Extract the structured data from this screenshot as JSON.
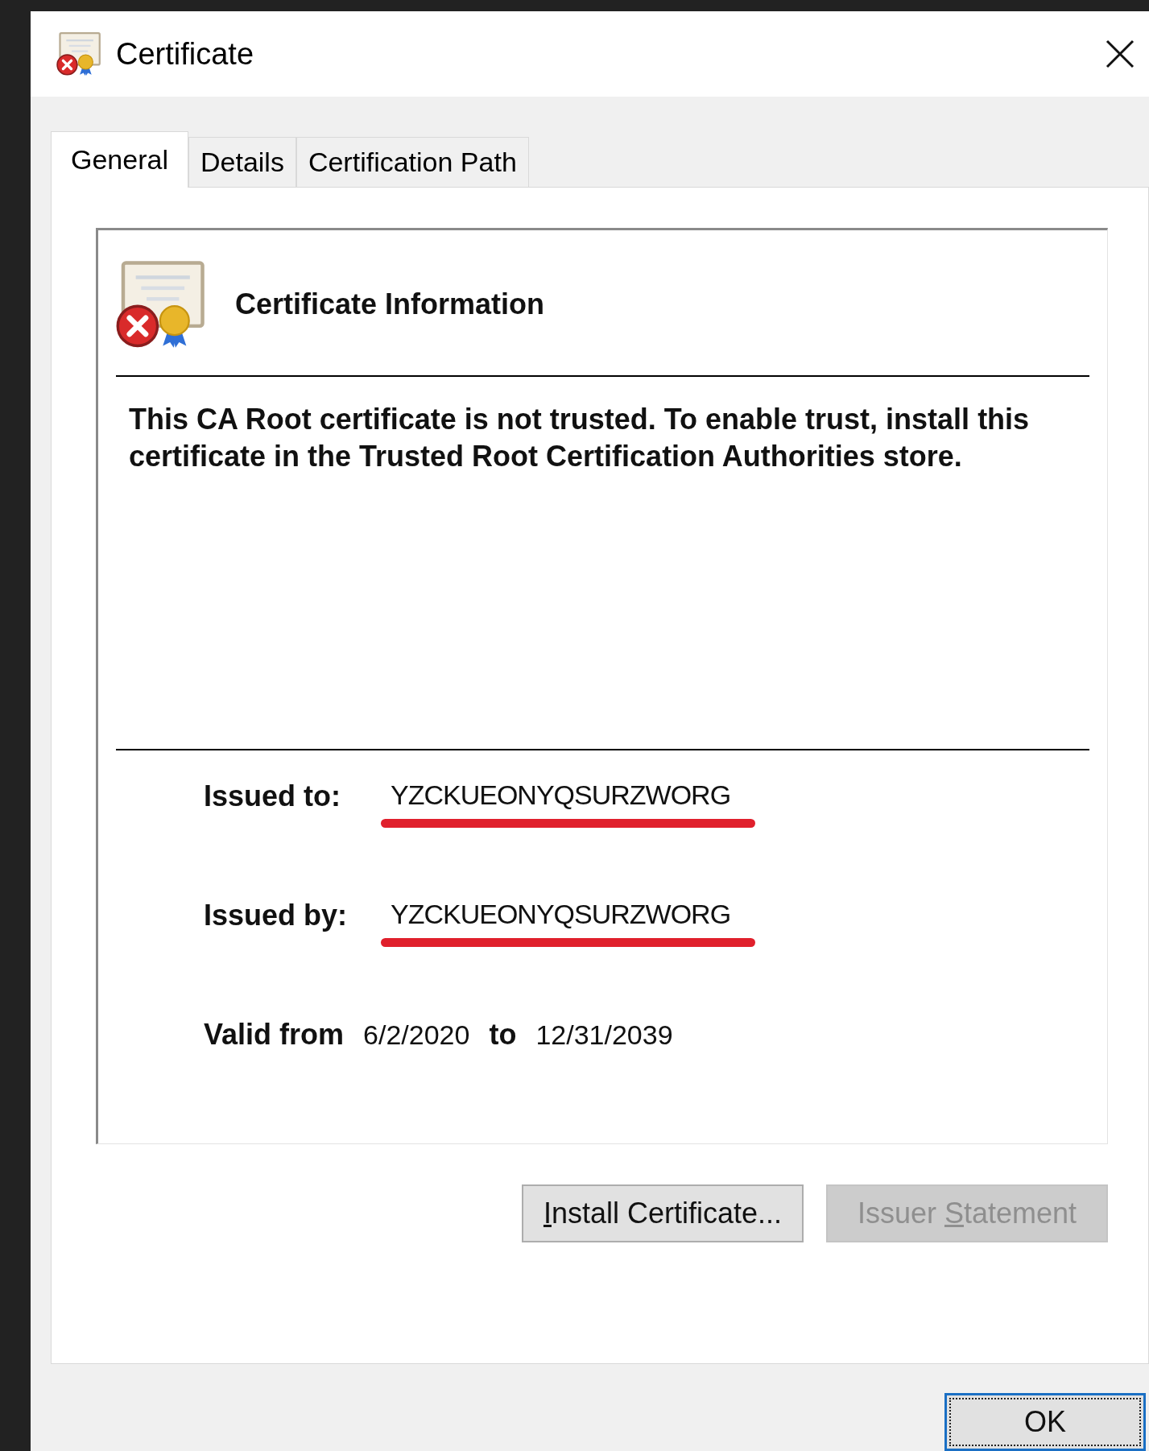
{
  "window": {
    "title": "Certificate"
  },
  "tabs": [
    {
      "label": "General",
      "selected": true
    },
    {
      "label": "Details",
      "selected": false
    },
    {
      "label": "Certification Path",
      "selected": false
    }
  ],
  "info": {
    "heading": "Certificate Information",
    "message": "This CA Root certificate is not trusted. To enable trust, install this certificate in the Trusted Root Certification Authorities store.",
    "fields": [
      {
        "label": "Issued to:",
        "value": "YZCKUEONYQSURZWORG",
        "marked": true
      },
      {
        "label": "Issued by:",
        "value": "YZCKUEONYQSURZWORG",
        "marked": true
      }
    ],
    "validity": {
      "from_label": "Valid from",
      "from": "6/2/2020",
      "to_label": "to",
      "to": "12/31/2039"
    }
  },
  "panel_buttons": [
    {
      "key": "I",
      "after": "nstall Certificate...",
      "disabled": false
    },
    {
      "before": "Issuer ",
      "key": "S",
      "after": "tatement",
      "disabled": true
    }
  ],
  "footer_buttons": [
    {
      "label": "OK",
      "focused": true
    }
  ]
}
